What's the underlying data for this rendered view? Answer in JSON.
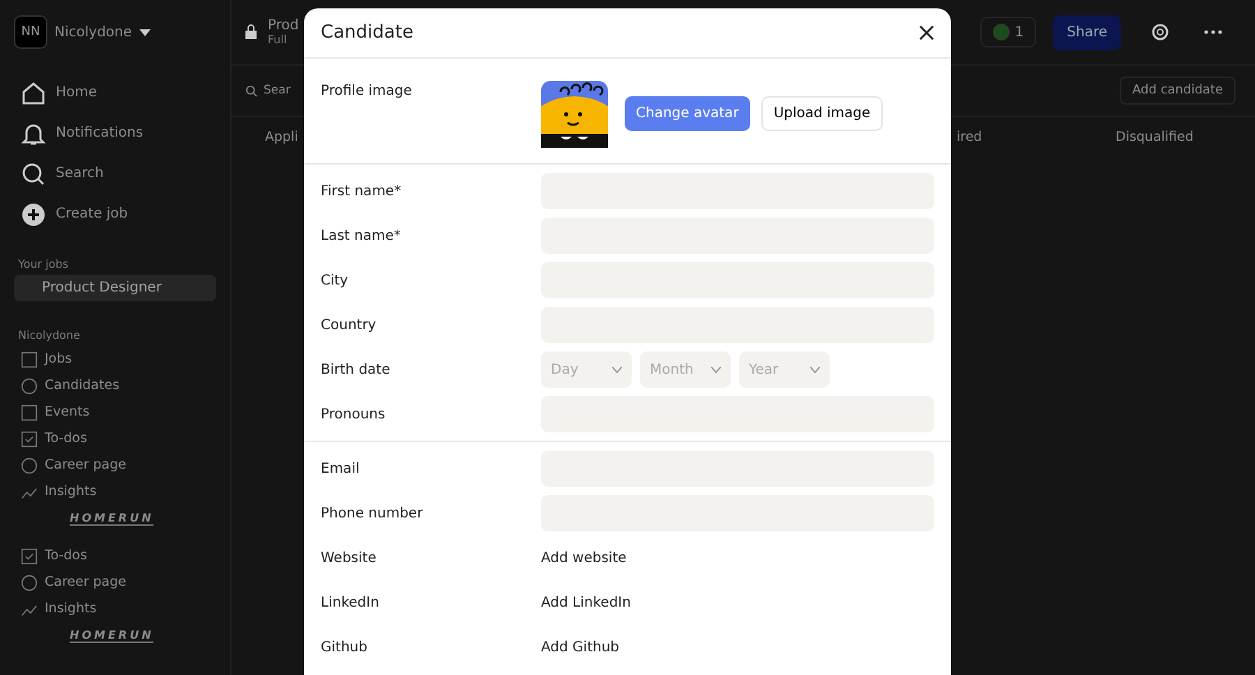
{
  "workspace": {
    "initials": "NN",
    "name": "Nicolydone"
  },
  "nav": [
    {
      "label": "Home"
    },
    {
      "label": "Notifications"
    },
    {
      "label": "Search"
    },
    {
      "label": "Create job"
    }
  ],
  "your_jobs": {
    "heading": "Your jobs",
    "items": [
      {
        "label": "Product Designer",
        "selected": true
      }
    ]
  },
  "team": {
    "heading": "Nicolydone",
    "items": [
      {
        "label": "Jobs"
      },
      {
        "label": "Candidates"
      },
      {
        "label": "Events"
      },
      {
        "label": "To-dos"
      },
      {
        "label": "Career page"
      },
      {
        "label": "Insights"
      }
    ],
    "logo": "HOMERUN"
  },
  "team_repeat": {
    "items": [
      {
        "label": "To-dos"
      },
      {
        "label": "Career page"
      },
      {
        "label": "Insights"
      }
    ],
    "logo": "HOMERUN"
  },
  "header": {
    "title": "Prod",
    "subtitle": "Full",
    "member_count": "1",
    "share": "Share"
  },
  "toolbar": {
    "search": "Sear",
    "add": "Add candidate"
  },
  "columns": [
    "Appli",
    "ired",
    "Disqualified"
  ],
  "modal": {
    "title": "Candidate",
    "profile_label": "Profile image",
    "change_avatar": "Change avatar",
    "upload": "Upload image",
    "sections": [
      [
        {
          "kind": "input",
          "label": "First name*"
        },
        {
          "kind": "input",
          "label": "Last name*"
        },
        {
          "kind": "input",
          "label": "City"
        },
        {
          "kind": "input",
          "label": "Country"
        },
        {
          "kind": "date",
          "label": "Birth date",
          "selects": [
            "Day",
            "Month",
            "Year"
          ]
        },
        {
          "kind": "input",
          "label": "Pronouns"
        }
      ],
      [
        {
          "kind": "input",
          "label": "Email"
        },
        {
          "kind": "input",
          "label": "Phone number"
        },
        {
          "kind": "link",
          "label": "Website",
          "action": "Add website"
        },
        {
          "kind": "link",
          "label": "LinkedIn",
          "action": "Add LinkedIn"
        },
        {
          "kind": "link",
          "label": "Github",
          "action": "Add Github"
        }
      ]
    ]
  }
}
